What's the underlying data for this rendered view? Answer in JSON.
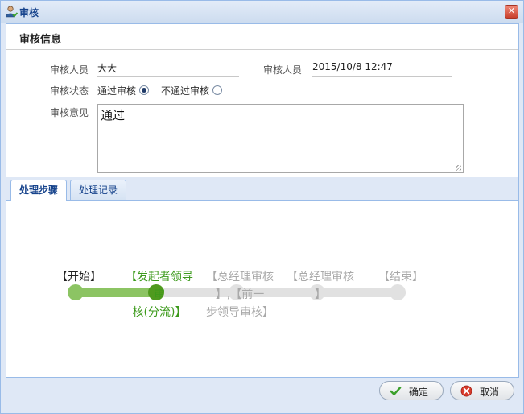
{
  "window": {
    "title": "审核",
    "close_label": "✕"
  },
  "audit_info": {
    "section_title": "审核信息",
    "auditor_label": "审核人员",
    "auditor_value": "大大",
    "time_label": "审核人员",
    "time_value": "2015/10/8 12:47",
    "status_label": "审核状态",
    "status_options": [
      {
        "label": "通过审核",
        "selected": true
      },
      {
        "label": "不通过审核",
        "selected": false
      }
    ],
    "opinion_label": "审核意见",
    "opinion_value": "通过"
  },
  "tabs": [
    {
      "label": "处理步骤",
      "active": true
    },
    {
      "label": "处理记录",
      "active": false
    }
  ],
  "workflow": {
    "steps": [
      {
        "label": "【开始】",
        "state": "done"
      },
      {
        "label": "【发起者领导审核(分流)】",
        "state": "current"
      },
      {
        "label": "【总经理审核】,【前一步领导审核】",
        "state": "todo"
      },
      {
        "label": "【总经理审核】",
        "state": "todo"
      },
      {
        "label": "【结束】",
        "state": "todo"
      }
    ],
    "progress_fraction": 0.25
  },
  "buttons": {
    "confirm_label": "确定",
    "cancel_label": "取消"
  },
  "colors": {
    "done": "#8cc463",
    "current": "#4f9a1e",
    "todo": "#e1e1e1",
    "accent": "#15428b"
  }
}
